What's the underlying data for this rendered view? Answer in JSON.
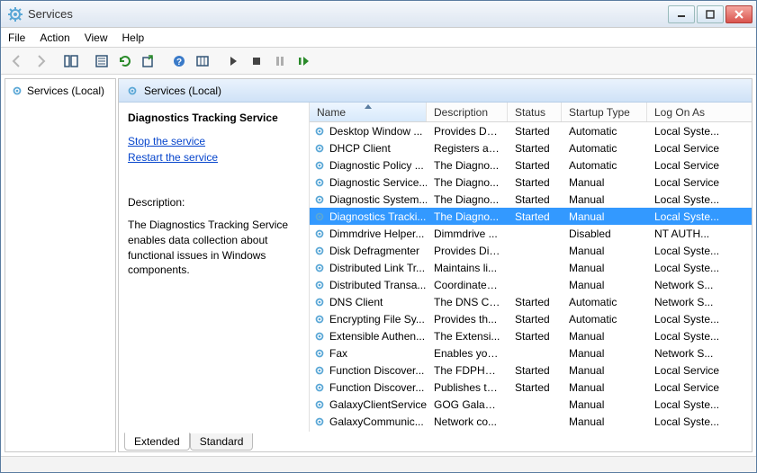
{
  "window": {
    "title": "Services"
  },
  "menubar": [
    "File",
    "Action",
    "View",
    "Help"
  ],
  "left": {
    "node": "Services (Local)"
  },
  "pane_header": "Services (Local)",
  "detail": {
    "service_name": "Diagnostics Tracking Service",
    "stop_link": "Stop",
    "stop_suffix": " the service",
    "restart_link": "Restart",
    "restart_suffix": " the service",
    "desc_label": "Description:",
    "desc_text": "The Diagnostics Tracking Service enables data collection about functional issues in Windows components."
  },
  "columns": {
    "name": "Name",
    "description": "Description",
    "status": "Status",
    "startup": "Startup Type",
    "logon": "Log On As"
  },
  "services": [
    {
      "name": "Desktop Window ...",
      "desc": "Provides De...",
      "status": "Started",
      "startup": "Automatic",
      "logon": "Local Syste..."
    },
    {
      "name": "DHCP Client",
      "desc": "Registers an...",
      "status": "Started",
      "startup": "Automatic",
      "logon": "Local Service"
    },
    {
      "name": "Diagnostic Policy ...",
      "desc": "The Diagno...",
      "status": "Started",
      "startup": "Automatic",
      "logon": "Local Service"
    },
    {
      "name": "Diagnostic Service...",
      "desc": "The Diagno...",
      "status": "Started",
      "startup": "Manual",
      "logon": "Local Service"
    },
    {
      "name": "Diagnostic System...",
      "desc": "The Diagno...",
      "status": "Started",
      "startup": "Manual",
      "logon": "Local Syste..."
    },
    {
      "name": "Diagnostics Tracki...",
      "desc": "The Diagno...",
      "status": "Started",
      "startup": "Manual",
      "logon": "Local Syste...",
      "selected": true
    },
    {
      "name": "Dimmdrive Helper...",
      "desc": "Dimmdrive ...",
      "status": "",
      "startup": "Disabled",
      "logon": "NT AUTH..."
    },
    {
      "name": "Disk Defragmenter",
      "desc": "Provides Dis...",
      "status": "",
      "startup": "Manual",
      "logon": "Local Syste..."
    },
    {
      "name": "Distributed Link Tr...",
      "desc": "Maintains li...",
      "status": "",
      "startup": "Manual",
      "logon": "Local Syste..."
    },
    {
      "name": "Distributed Transa...",
      "desc": "Coordinates...",
      "status": "",
      "startup": "Manual",
      "logon": "Network S..."
    },
    {
      "name": "DNS Client",
      "desc": "The DNS Cli...",
      "status": "Started",
      "startup": "Automatic",
      "logon": "Network S..."
    },
    {
      "name": "Encrypting File Sy...",
      "desc": "Provides th...",
      "status": "Started",
      "startup": "Automatic",
      "logon": "Local Syste..."
    },
    {
      "name": "Extensible Authen...",
      "desc": "The Extensi...",
      "status": "Started",
      "startup": "Manual",
      "logon": "Local Syste..."
    },
    {
      "name": "Fax",
      "desc": "Enables you...",
      "status": "",
      "startup": "Manual",
      "logon": "Network S..."
    },
    {
      "name": "Function Discover...",
      "desc": "The FDPHO...",
      "status": "Started",
      "startup": "Manual",
      "logon": "Local Service"
    },
    {
      "name": "Function Discover...",
      "desc": "Publishes th...",
      "status": "Started",
      "startup": "Manual",
      "logon": "Local Service"
    },
    {
      "name": "GalaxyClientService",
      "desc": "GOG Galaxy...",
      "status": "",
      "startup": "Manual",
      "logon": "Local Syste..."
    },
    {
      "name": "GalaxyCommunic...",
      "desc": "Network co...",
      "status": "",
      "startup": "Manual",
      "logon": "Local Syste..."
    }
  ],
  "tabs": {
    "extended": "Extended",
    "standard": "Standard"
  }
}
